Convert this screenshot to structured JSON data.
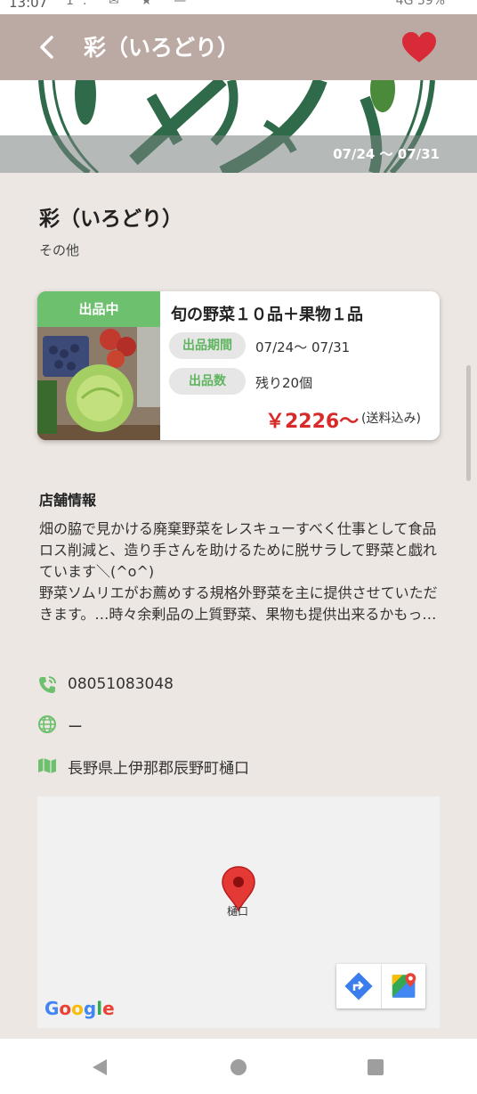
{
  "status_bar": {
    "time": "13:07",
    "right_text": "4G 39%"
  },
  "app_bar": {
    "title": "彩（いろどり）"
  },
  "hero": {
    "period": "07/24 〜 07/31"
  },
  "shop": {
    "name": "彩（いろどり）",
    "category": "その他"
  },
  "listing": {
    "badge": "出品中",
    "name": "旬の野菜１０品＋果物１品",
    "period_label": "出品期間",
    "period_value": "07/24〜 07/31",
    "count_label": "出品数",
    "count_value": "残り20個",
    "price": "￥2226〜",
    "shipping": "(送料込み)"
  },
  "store_info": {
    "title": "店舗情報",
    "description": "畑の脇で見かける廃棄野菜をレスキューすべく仕事として食品ロス削減と、造り手さんを助けるために脱サラして野菜と戯れています＼(^o^)\n野菜ソムリエがお薦めする規格外野菜を主に提供させていただきます。…時々余剰品の上質野菜、果物も提供出来るかもっ…",
    "phone": "08051083048",
    "website": "ー",
    "address": "長野県上伊那郡辰野町樋口"
  },
  "map": {
    "pin_label": "樋口",
    "logo_letters": [
      "G",
      "o",
      "o",
      "g",
      "l",
      "e"
    ]
  },
  "colors": {
    "app_bar": "#bbaaa3",
    "accent_green": "#6dc06d",
    "price_red": "#d82a2a",
    "heart": "#d92b37"
  }
}
